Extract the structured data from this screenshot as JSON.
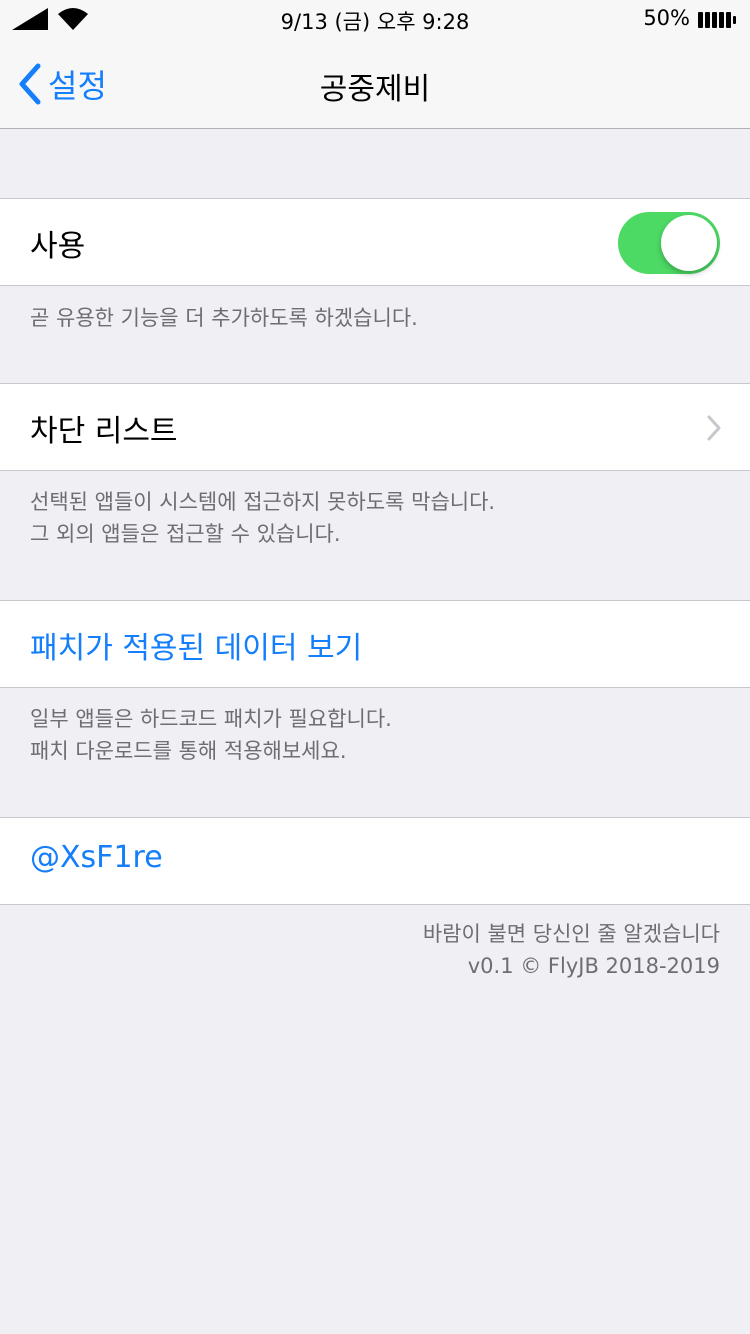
{
  "status_bar": {
    "time": "9/13 (금) 오후 9:28",
    "battery": "50%",
    "icons": [
      "signal-icon",
      "wifi-icon",
      "battery-icon"
    ]
  },
  "nav": {
    "back_label": "설정",
    "title": "공중제비"
  },
  "sections": {
    "enable": {
      "label": "사용",
      "toggle_on": true,
      "footer": "곧 유용한 기능을 더 추가하도록 하겠습니다."
    },
    "blocklist": {
      "label": "차단 리스트",
      "footer_line1": "선택된 앱들이 시스템에 접근하지 못하도록 막습니다.",
      "footer_line2": "그 외의 앱들은 접근할 수 있습니다."
    },
    "patch": {
      "label": "패치가 적용된 데이터 보기",
      "footer_line1": "일부 앱들은 하드코드 패치가 필요합니다.",
      "footer_line2": "패치 다운로드를 통해 적용해보세요."
    },
    "author": {
      "label": "@XsF1re"
    }
  },
  "credits": {
    "line1": "바람이 불면 당신인 줄 알겠습니다",
    "line2": "v0.1 © FlyJB 2018-2019"
  },
  "colors": {
    "accent": "#147efb",
    "toggle_on": "#4cd964",
    "background": "#efeff4"
  }
}
